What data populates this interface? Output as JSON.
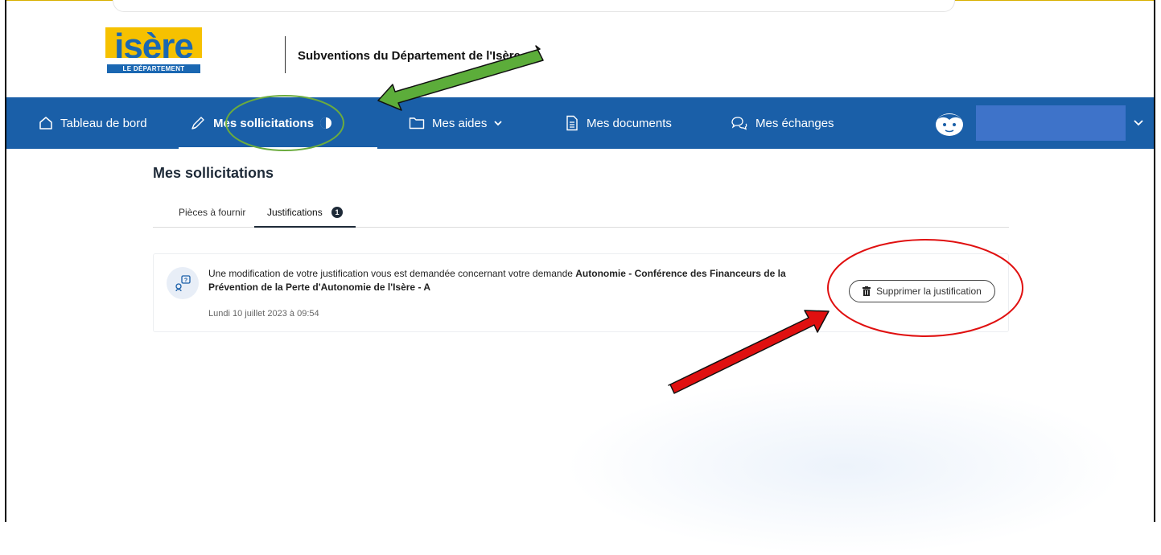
{
  "header": {
    "logo_text": "isère",
    "logo_subtitle": "LE DÉPARTEMENT",
    "site_title": "Subventions du Département de l'Isère"
  },
  "nav": {
    "items": [
      {
        "label": "Tableau de bord",
        "icon": "home-icon"
      },
      {
        "label": "Mes sollicitations",
        "icon": "pen-icon",
        "active": true
      },
      {
        "label": "Mes aides",
        "icon": "folder-icon",
        "has_dropdown": true
      },
      {
        "label": "Mes documents",
        "icon": "document-icon"
      },
      {
        "label": "Mes échanges",
        "icon": "chat-icon"
      }
    ],
    "user_icon": "avatar-icon"
  },
  "main": {
    "page_title": "Mes sollicitations",
    "tabs": [
      {
        "label": "Pièces à fournir"
      },
      {
        "label": "Justifications",
        "count": "1",
        "active": true
      }
    ],
    "card": {
      "icon": "question-icon",
      "message_prefix": "Une modification de votre justification vous est demandée concernant votre demande ",
      "message_bold": "Autonomie - Conférence des Financeurs de la Prévention de la Perte d'Autonomie de l'Isère - A",
      "date": "Lundi 10 juillet 2023 à 09:54",
      "delete_label": "Supprimer la justification"
    }
  },
  "colors": {
    "nav_bg": "#1a5fa8",
    "logo_yellow": "#f6c100",
    "logo_blue": "#1a67b2",
    "annotation_green": "#6bab3e",
    "annotation_red": "#e01010"
  }
}
